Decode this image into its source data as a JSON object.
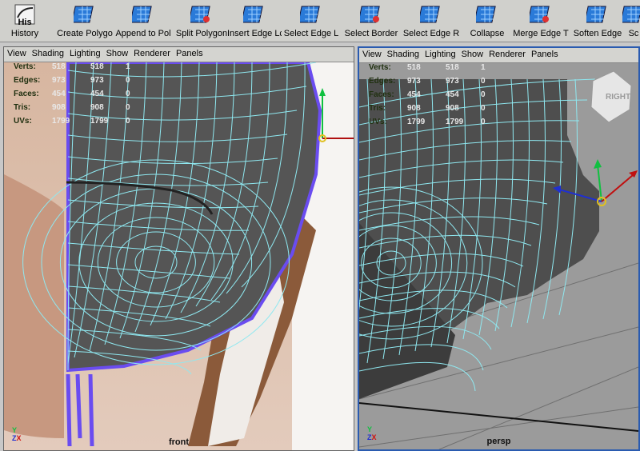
{
  "shelf": {
    "tools": [
      {
        "label": "His",
        "label2": "History",
        "icon": "history-icon"
      },
      {
        "label": "Create Polygo",
        "icon": "create-polygon-icon"
      },
      {
        "label": "Append to Pol",
        "icon": "append-polygon-icon"
      },
      {
        "label": "Split Polygon",
        "icon": "split-polygon-icon"
      },
      {
        "label": "Insert Edge Lc",
        "icon": "insert-edge-loop-icon"
      },
      {
        "label": "Select Edge L",
        "icon": "select-edge-loop-icon"
      },
      {
        "label": "Select Border",
        "icon": "select-border-icon"
      },
      {
        "label": "Select Edge R",
        "icon": "select-edge-ring-icon"
      },
      {
        "label": "Collapse",
        "icon": "collapse-icon"
      },
      {
        "label": "Merge Edge T",
        "icon": "merge-edge-icon"
      },
      {
        "label": "Soften Edge",
        "icon": "soften-edge-icon"
      },
      {
        "label": "Sc",
        "icon": "sculpt-icon"
      }
    ]
  },
  "viewports": {
    "menu": [
      "View",
      "Shading",
      "Lighting",
      "Show",
      "Renderer",
      "Panels"
    ],
    "hud": [
      {
        "label": "Verts:",
        "a": "518",
        "b": "518",
        "c": "1"
      },
      {
        "label": "Edges:",
        "a": "973",
        "b": "973",
        "c": "0"
      },
      {
        "label": "Faces:",
        "a": "454",
        "b": "454",
        "c": "0"
      },
      {
        "label": "Tris:",
        "a": "908",
        "b": "908",
        "c": "0"
      },
      {
        "label": "UVs:",
        "a": "1799",
        "b": "1799",
        "c": "0"
      }
    ],
    "front_label": "front",
    "persp_label": "persp",
    "viewcube_face": "RIGHT"
  },
  "colors": {
    "wire": "#8fe8f0",
    "mesh": "#5a5a5a",
    "selection": "#6a4cf0",
    "active_border": "#2a5bb0"
  }
}
